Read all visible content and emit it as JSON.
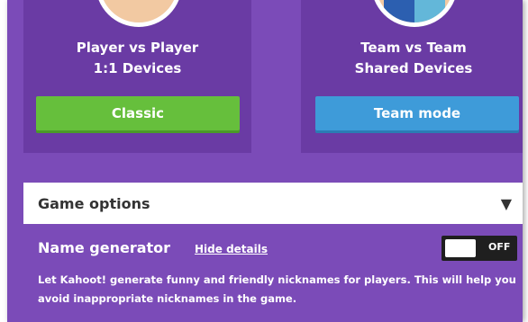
{
  "cards": [
    {
      "line1": "Player vs Player",
      "line2": "1:1 Devices",
      "button": "Classic",
      "color": "#66bf3c"
    },
    {
      "line1": "Team vs Team",
      "line2": "Shared Devices",
      "button": "Team mode",
      "color": "#3e9bd9"
    }
  ],
  "options": {
    "title": "Game options",
    "arrow": "▼"
  },
  "name_generator": {
    "label": "Name generator",
    "hide_link": "Hide details",
    "toggle_state": "OFF",
    "description": "Let Kahoot! generate funny and friendly nicknames for players. This will help you avoid inappropriate nicknames in the game."
  },
  "colors": {
    "background": "#7b4bb8",
    "card": "#6a3ba4",
    "toggle": "#1f1f1f"
  }
}
